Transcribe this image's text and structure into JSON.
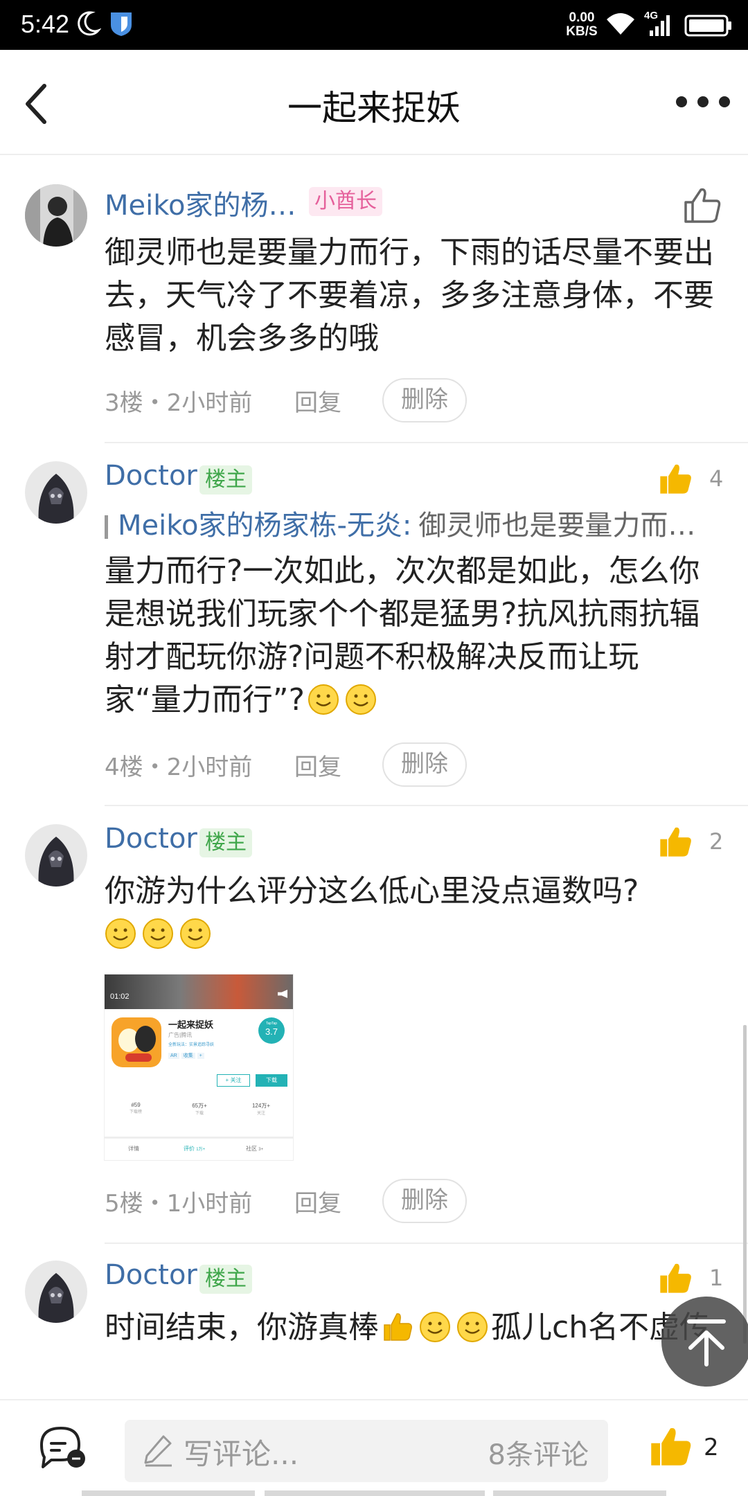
{
  "status_bar": {
    "time": "5:42",
    "net_speed_value": "0.00",
    "net_speed_unit": "KB/S",
    "network": "4G"
  },
  "header": {
    "title": "一起来捉妖"
  },
  "comments": [
    {
      "author": "Meiko家的杨…",
      "badge": "小酋长",
      "body": "御灵师也是要量力而行，下雨的话尽量不要出去，天气冷了不要着凉，多多注意身体，不要感冒，机会多多的哦",
      "floor_time": "3楼・2小时前",
      "reply": "回复",
      "delete": "删除"
    },
    {
      "author": "Doctor",
      "badge": "楼主",
      "likes": "4",
      "quote_author": "Meiko家的杨家栋-无炎:",
      "quote_text": "御灵师也是要量力而…",
      "body": "量力而行?一次如此，次次都是如此，怎么你是想说我们玩家个个都是猛男?抗风抗雨抗辐射才配玩你游?问题不积极解决反而让玩家“量力而行”?",
      "floor_time": "4楼・2小时前",
      "reply": "回复",
      "delete": "删除"
    },
    {
      "author": "Doctor",
      "badge": "楼主",
      "likes": "2",
      "body": "你游为什么评分这么低心里没点逼数吗?",
      "attachment": {
        "video_time": "01:02",
        "app_name": "一起来捉妖",
        "publisher": "广告|腾讯",
        "desc": "全新玩法：实景追踪寻妖",
        "score_label": "TapTap",
        "score": "3.7",
        "tag_ar": "AR",
        "tag_collect": "收集",
        "tag_plus": "+",
        "follow": "+ 关注",
        "download": "下载",
        "stat1_value": "#59",
        "stat1_label": "下载榜",
        "stat2_value": "65万+",
        "stat2_label": "下载",
        "stat3_value": "124万+",
        "stat3_label": "关注",
        "tab1": "详情",
        "tab2": "评价",
        "tab2_count": "1万+",
        "tab3": "社区",
        "tab3_count": "3+"
      },
      "floor_time": "5楼・1小时前",
      "reply": "回复",
      "delete": "删除"
    },
    {
      "author": "Doctor",
      "badge": "楼主",
      "likes": "1",
      "body_part1": "时间结束，你游真棒",
      "body_part2": "孤儿ch名不虚传"
    }
  ],
  "bottom_bar": {
    "placeholder": "写评论...",
    "comment_count": "8条评论",
    "likes": "2"
  },
  "colors": {
    "link_blue": "#3f6ea7",
    "badge_pink": "#e5609b",
    "badge_green": "#3fa64a",
    "like_yellow": "#f5b800"
  }
}
